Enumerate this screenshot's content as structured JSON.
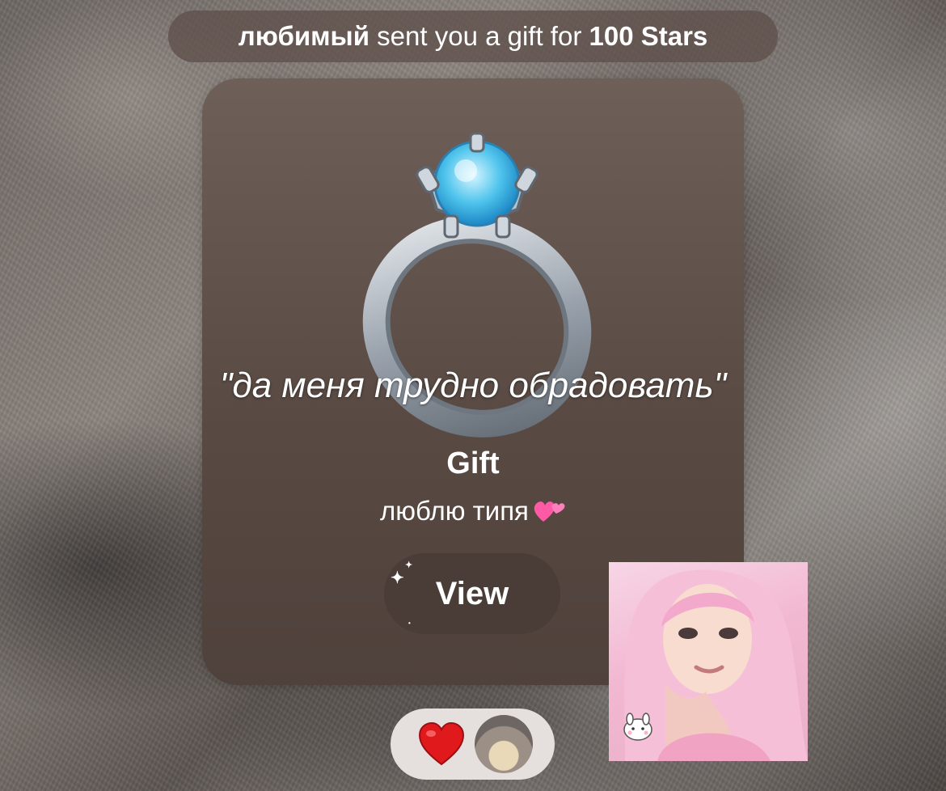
{
  "notice": {
    "sender": "любимый",
    "middle": " sent you a gift for ",
    "amount": "100 Stars"
  },
  "gift_card": {
    "caption": "\"да меня трудно обрадовать\"",
    "title": "Gift",
    "message": "люблю типя",
    "message_emoji": "two-hearts-emoji",
    "view_label": "View"
  },
  "reaction": {
    "emoji": "red-heart-emoji"
  },
  "colors": {
    "card_bg": "#594a43",
    "notice_bg": "#5f504a",
    "view_button_bg": "#4a3c37",
    "heart_red": "#e0191c"
  }
}
